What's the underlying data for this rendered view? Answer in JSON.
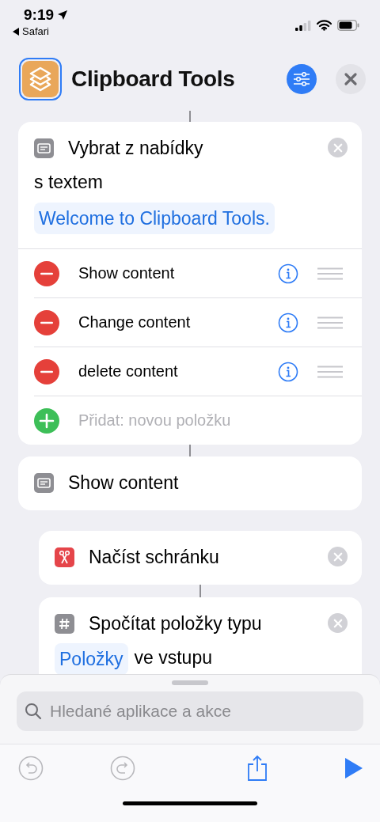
{
  "status_bar": {
    "time": "9:19",
    "back_label": "Safari"
  },
  "header": {
    "title": "Clipboard Tools",
    "icon_selected": true
  },
  "actions": [
    {
      "kind": "menu",
      "title": "Vybrat z nabídky",
      "removable": true,
      "parts": [
        {
          "kind": "text",
          "text": "s textem"
        },
        {
          "kind": "token",
          "text": "Welcome to Clipboard Tools."
        }
      ],
      "menu_items": [
        {
          "kind": "remove",
          "label": "Show content"
        },
        {
          "kind": "remove",
          "label": "Change content"
        },
        {
          "kind": "remove",
          "label": "delete content"
        },
        {
          "kind": "add",
          "placeholder": "Přidat: novou položku"
        }
      ]
    },
    {
      "kind": "menu",
      "title": "Show content",
      "removable": false,
      "children": [
        {
          "kind": "scissors",
          "title": "Načíst schránku",
          "removable": true
        },
        {
          "kind": "number",
          "title": "Spočítat položky typu",
          "removable": true,
          "parts": [
            {
              "kind": "token",
              "text": "Položky"
            },
            {
              "kind": "text",
              "text": "ve vstupu"
            }
          ]
        }
      ]
    }
  ],
  "search": {
    "placeholder": "Hledané aplikace a akce"
  },
  "toolbar": [
    {
      "kind": "undo",
      "disabled": true
    },
    {
      "kind": "redo",
      "disabled": true
    },
    {
      "kind": "share",
      "disabled": false
    },
    {
      "kind": "run",
      "disabled": false
    }
  ]
}
